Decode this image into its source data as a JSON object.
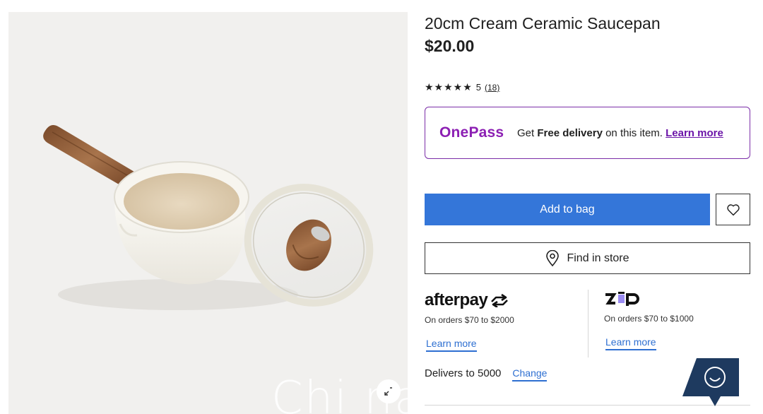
{
  "product": {
    "title": "20cm Cream Ceramic Saucepan",
    "price": "$20.00",
    "image_alt": "Cream ceramic saucepan with wood-look handle and glass lid"
  },
  "rating": {
    "stars": "★★★★★",
    "score": "5",
    "count": "(18)"
  },
  "onepass": {
    "logo": "OnePass",
    "text_prefix": "Get ",
    "text_bold": "Free delivery",
    "text_suffix": " on this item. ",
    "link": "Learn more"
  },
  "actions": {
    "add_to_bag": "Add to bag",
    "wishlist_icon": "heart-icon",
    "find_in_store": "Find in store",
    "find_icon": "location-pin-icon"
  },
  "payments": {
    "afterpay": {
      "logo": "afterpay",
      "note": "On orders $70 to $2000",
      "link": "Learn more"
    },
    "zip": {
      "logo": "zip",
      "note": "On orders $70 to $1000",
      "link": "Learn more"
    }
  },
  "delivery": {
    "text": "Delivers to 5000",
    "change": "Change"
  },
  "watermark": "Chi na",
  "colors": {
    "accent_blue": "#3476d9",
    "onepass_purple": "#8c1fb3",
    "zip_purple": "#9b8cf2",
    "chat_navy": "#1e3a5f"
  }
}
